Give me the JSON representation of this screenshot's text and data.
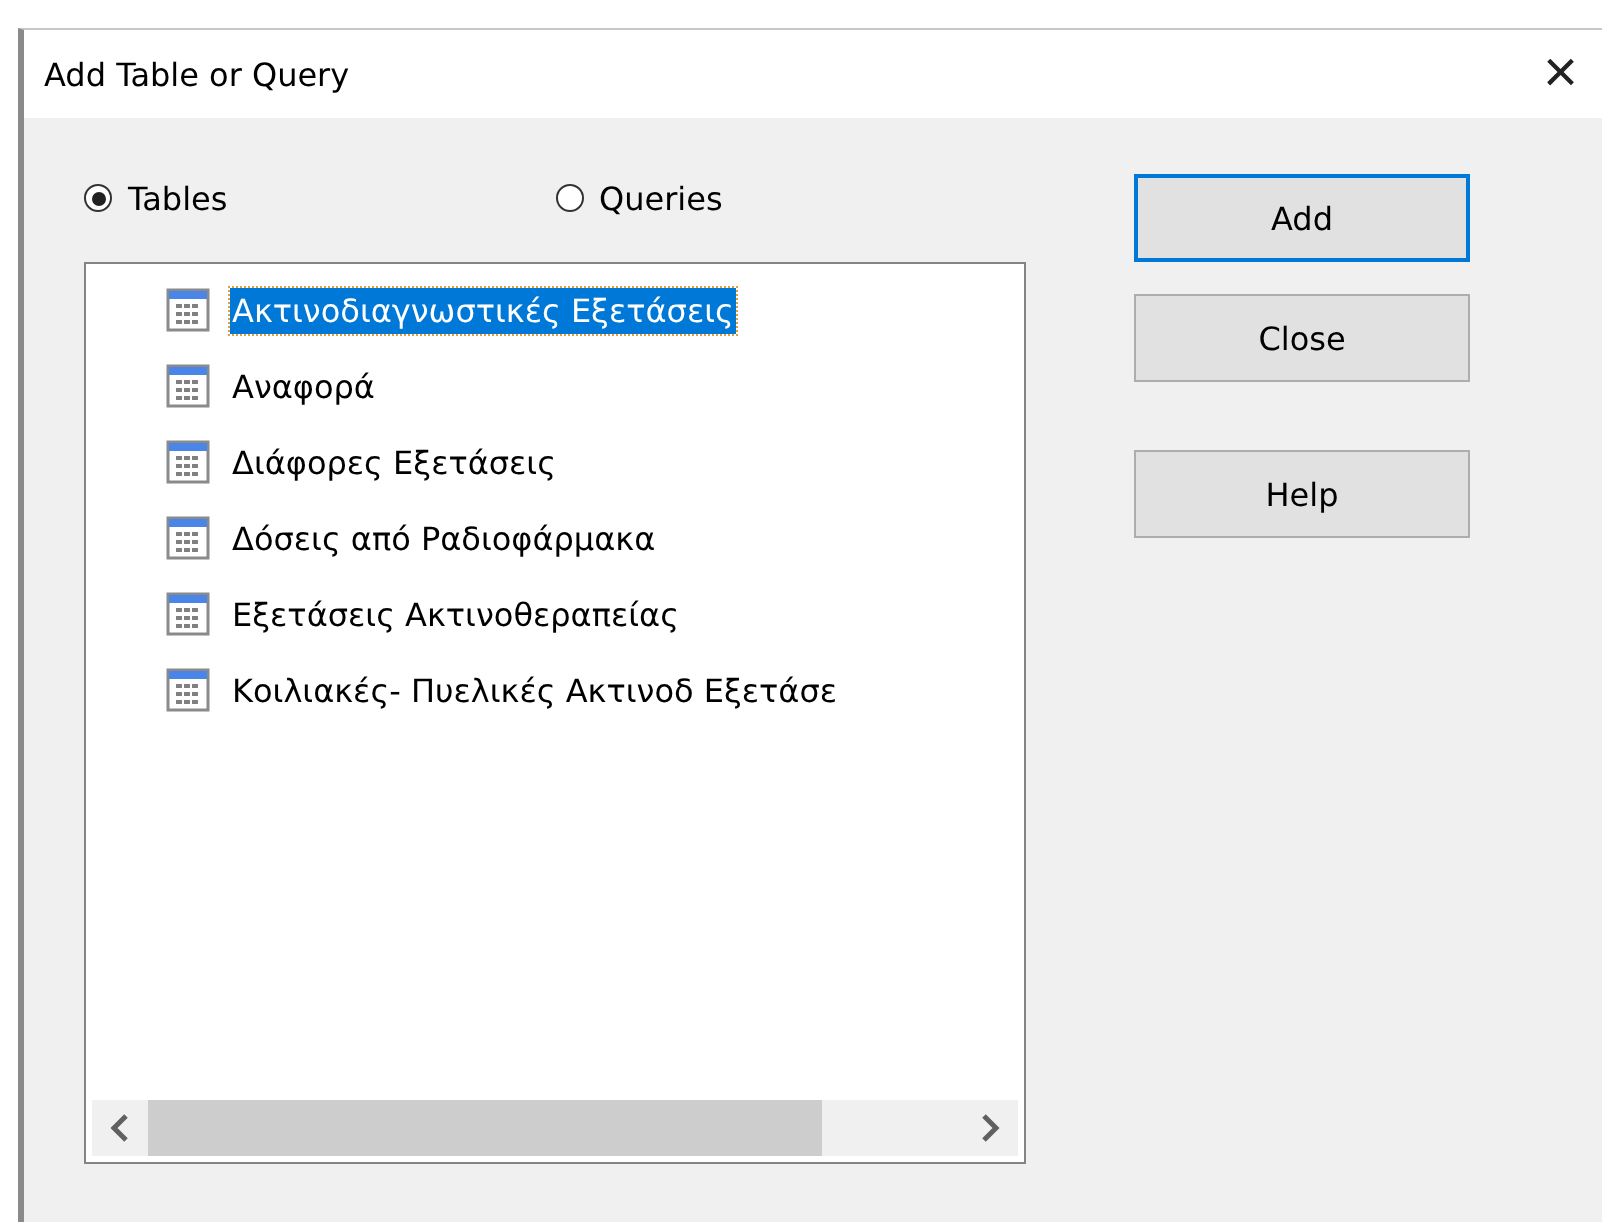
{
  "window": {
    "title": "Add Table or Query",
    "close": "×"
  },
  "source_options": [
    {
      "label": "Tables",
      "selected": true
    },
    {
      "label": "Queries",
      "selected": false
    }
  ],
  "tables": [
    {
      "name": "Ακτινοδιαγνωστικές Εξετάσεις",
      "selected": true
    },
    {
      "name": "Αναφορά",
      "selected": false
    },
    {
      "name": "Διάφορες Εξετάσεις",
      "selected": false
    },
    {
      "name": "Δόσεις από Ραδιοφάρμακα",
      "selected": false
    },
    {
      "name": "Εξετάσεις Ακτινοθεραπείας",
      "selected": false
    },
    {
      "name": "Κοιλιακές- Πυελικές Ακτινοδ Εξετάσε",
      "selected": false
    }
  ],
  "buttons": [
    {
      "label": "Add",
      "default": true
    },
    {
      "label": "Close",
      "default": false
    },
    {
      "label": "Help",
      "default": false
    }
  ]
}
